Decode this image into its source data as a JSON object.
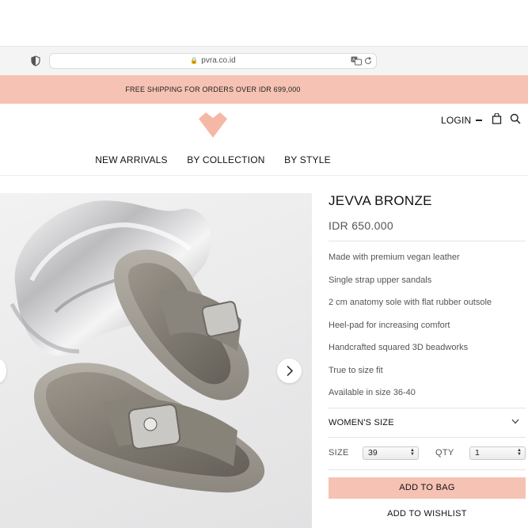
{
  "browser": {
    "url": "pvra.co.id"
  },
  "promo": {
    "text": "FREE SHIPPING FOR ORDERS OVER IDR 699,000"
  },
  "header": {
    "login_label": "LOGIN",
    "nav": [
      "NEW ARRIVALS",
      "BY COLLECTION",
      "BY STYLE"
    ]
  },
  "product": {
    "title": "JEVVA BRONZE",
    "price": "IDR 650.000",
    "features": [
      "Made with premium vegan leather",
      "Single strap upper sandals",
      "2 cm anatomy sole with flat rubber outsole",
      "Heel-pad for increasing comfort",
      "Handcrafted squared 3D beadworks",
      "True to size fit",
      "Available in size 36-40"
    ],
    "size_section_label": "WOMEN'S SIZE",
    "size_label": "SIZE",
    "size_value": "39",
    "qty_label": "QTY",
    "qty_value": "1",
    "add_to_bag": "ADD TO BAG",
    "add_to_wishlist": "ADD TO WISHLIST"
  },
  "colors": {
    "accent": "#f6c2b4",
    "text": "#111111",
    "muted": "#555555"
  },
  "icons": [
    "shield-icon",
    "lock-icon",
    "translate-icon",
    "reload-icon",
    "heart-logo",
    "minus-icon",
    "bag-icon",
    "search-icon",
    "chevron-down-icon",
    "chevron-right-icon"
  ]
}
